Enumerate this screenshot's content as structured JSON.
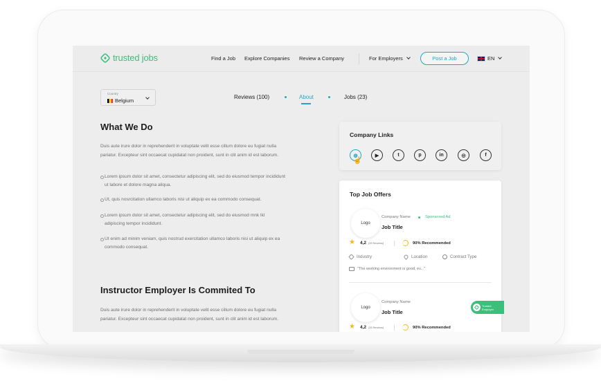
{
  "header": {
    "logo": "trusted jobs",
    "nav": [
      "Find a Job",
      "Explore Companies",
      "Review a Company"
    ],
    "for_employers": "For Employers",
    "post_job": "Post a Job",
    "language": "EN"
  },
  "country_select": {
    "label": "Country",
    "value": "Belgium"
  },
  "tabs": [
    {
      "label": "Reviews (100)",
      "active": false
    },
    {
      "label": "About",
      "active": true
    },
    {
      "label": "Jobs (23)",
      "active": false
    }
  ],
  "about": {
    "heading": "What We Do",
    "paragraph_1": "Duis aute irure dolor in reprehenderit in voluptate velit esse cillum dolore eu fugiat nulla",
    "paragraph_2": "pariatur. Excepteur sint occaecat cupidatat non proident, sunt in clit anim id est laborum.",
    "bullets": [
      [
        "Lorem ipsum dolor sit amet, consectetur adipiscing elit, sed do eiusmod tempor incididunt",
        "ut labore et dolore magna aliqua."
      ],
      [
        "Ut, quis nosrcitation ullamco laboris nisi ut aliquip ex ea commodo consequat."
      ],
      [
        "Lorem ipsum dolor sit amet, consectetur adipiscing elit, sed do eiusmod mnk lkl",
        "adipiscing tempor incididunt."
      ],
      [
        "Ut enim ad minim veniam, quis nostrud exercitation ullamco laboris nisi ut aliquip ex ea",
        "commodo consequat."
      ]
    ],
    "heading_2": "Instructor Employer Is Commited To",
    "paragraph_3": "Duis aute irure dolor in reprehenderit in voluptate velit esse cillum dolore eu fugiat nulla",
    "paragraph_4": "pariatur. Excepteur sint occaecat cupidatat non proident, sunt in clit anim id est laborum."
  },
  "company_links": {
    "title": "Company Links",
    "icons": [
      "website-icon",
      "youtube-icon",
      "twitter-icon",
      "pinterest-icon",
      "linkedin-icon",
      "instagram-icon",
      "facebook-icon"
    ],
    "glyphs": [
      "◍",
      "▶",
      "t",
      "p",
      "in",
      "◎",
      "f"
    ]
  },
  "top_jobs": {
    "title": "Top Job Offers",
    "offers": [
      {
        "logo": "Logo",
        "company": "Company Name",
        "sponsored": "Sponsored Ad",
        "title": "Job Title",
        "rating": "4,2",
        "reviews": "(33 Reviews)",
        "recommended": "90% Recommended",
        "industry": "Industry",
        "location": "Location",
        "contract": "Contract Type",
        "quote": "\"The working environment is good, ev...\""
      },
      {
        "logo": "Logo",
        "company": "Company Name",
        "title": "Job Title",
        "badge": [
          "Trusted",
          "Employer"
        ],
        "rating": "4,2",
        "reviews": "(33 Reviews)",
        "recommended": "90% Recommended"
      }
    ]
  },
  "colors": {
    "accent": "#20a6c4",
    "brand_green": "#3bbf7a",
    "star": "#f5b91a"
  }
}
